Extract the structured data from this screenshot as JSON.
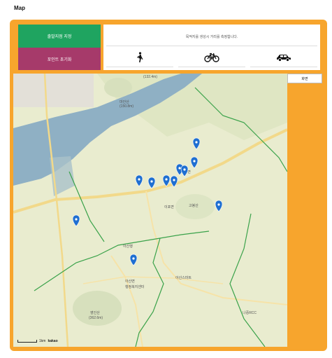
{
  "page": {
    "title": "Map"
  },
  "buttons": {
    "start_label": "출발지점 지정",
    "reset_label": "포인트 초기화"
  },
  "info": {
    "message": "목적지를 생성시 거리를 측정합니다."
  },
  "modes": [
    {
      "name": "walk",
      "icon": "walking-person-icon"
    },
    {
      "name": "bike",
      "icon": "bicycle-icon"
    },
    {
      "name": "car",
      "icon": "car-icon"
    }
  ],
  "map": {
    "side_tab_label": "화면",
    "scale_label": "1km",
    "provider_label": "kakao",
    "place_labels": [
      "마안산",
      "(150.8m)",
      "이포면",
      "고봉산",
      "아산행",
      "청계면",
      "아산면",
      "행정복지센터",
      "영인산",
      "(362.6m)",
      "아산스마트",
      "나중RCC",
      "(132.4m)"
    ],
    "marker_count": 11,
    "colors": {
      "land": "#e9eccf",
      "river": "#8fb0c4",
      "road": "#f2d98a",
      "boundary": "#3aa24a",
      "marker": "#1f6fd1"
    }
  }
}
